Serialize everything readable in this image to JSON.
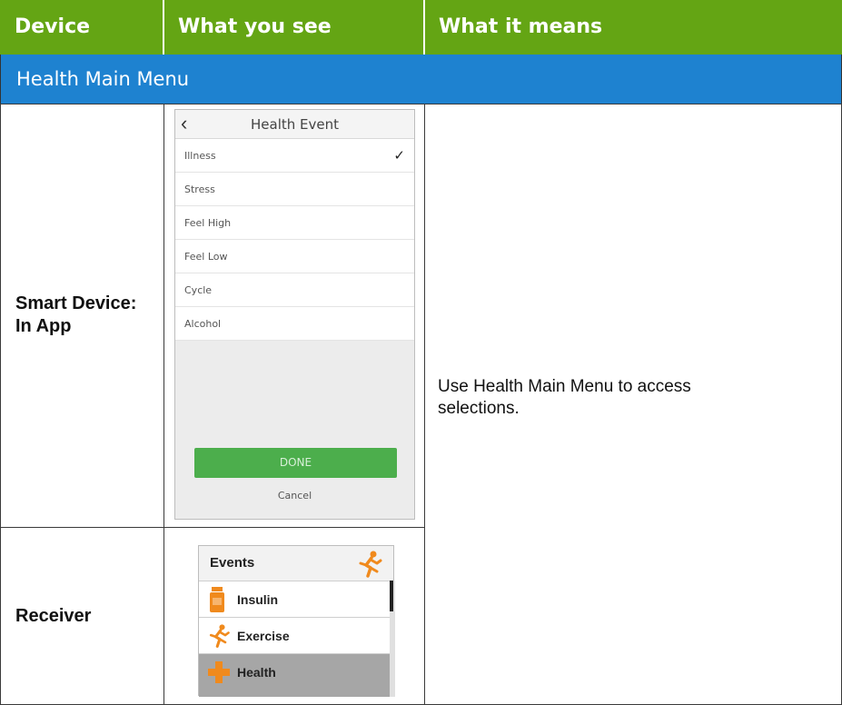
{
  "header": {
    "col_device": "Device",
    "col_see": "What you see",
    "col_means": "What it means"
  },
  "section": {
    "title": "Health Main Menu"
  },
  "rows": {
    "smart_device_label": "Smart Device:\nIn App",
    "receiver_label": "Receiver",
    "meaning": "Use Health Main Menu to access selections."
  },
  "phone": {
    "title": "Health Event",
    "back_glyph": "‹",
    "items": [
      "Illness",
      "Stress",
      "Feel High",
      "Feel Low",
      "Cycle",
      "Alcohol"
    ],
    "checked_glyph": "✓",
    "done_label": "DONE",
    "cancel_label": "Cancel"
  },
  "receiver": {
    "title": "Events",
    "items": [
      "Insulin",
      "Exercise",
      "Health"
    ],
    "selected": "Health"
  },
  "colors": {
    "header_green": "#64a514",
    "section_blue": "#1e82d0",
    "done_green": "#4cae4c",
    "icon_orange": "#f08a1d"
  }
}
